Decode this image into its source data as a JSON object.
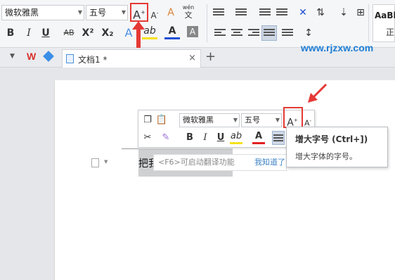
{
  "ribbon": {
    "font_name": "微软雅黑",
    "font_size": "五号",
    "grow_font": "A",
    "grow_sup": "+",
    "shrink_font": "A",
    "shrink_sup": "-",
    "clear_format": "A",
    "phonetic": "wén",
    "phonetic_char": "文",
    "bold": "B",
    "italic": "I",
    "underline": "U",
    "strikethrough": "AB",
    "superscript": "X²",
    "subscript": "X₂",
    "text_effect": "A",
    "highlight": "ab",
    "font_color": "A",
    "char_shading": "A",
    "style_preview": "AaBb",
    "style_name": "正"
  },
  "tabs": {
    "doc_title": "文档1 *",
    "close": "×",
    "add": "+"
  },
  "watermark": "www.rjzxw.com",
  "mini_toolbar": {
    "font_name": "微软雅黑",
    "font_size": "五号",
    "grow_font": "A",
    "grow_sup": "+",
    "shrink_font": "A",
    "shrink_sup": "-",
    "bold": "B",
    "italic": "I",
    "underline": "U",
    "highlight": "ab",
    "font_color": "A"
  },
  "tooltip": {
    "title": "增大字号 (Ctrl+])",
    "description": "增大字体的字号。"
  },
  "translate_bar": {
    "hint": "<F6>可启动翻译功能",
    "dismiss": "我知道了"
  },
  "document": {
    "text": "把我"
  },
  "colors": {
    "highlight_yellow": "#f5e11a",
    "font_red": "#e02020",
    "font_blue": "#1e4fd6",
    "annotation_red": "#e53935",
    "accent_blue": "#1e7fd6"
  }
}
